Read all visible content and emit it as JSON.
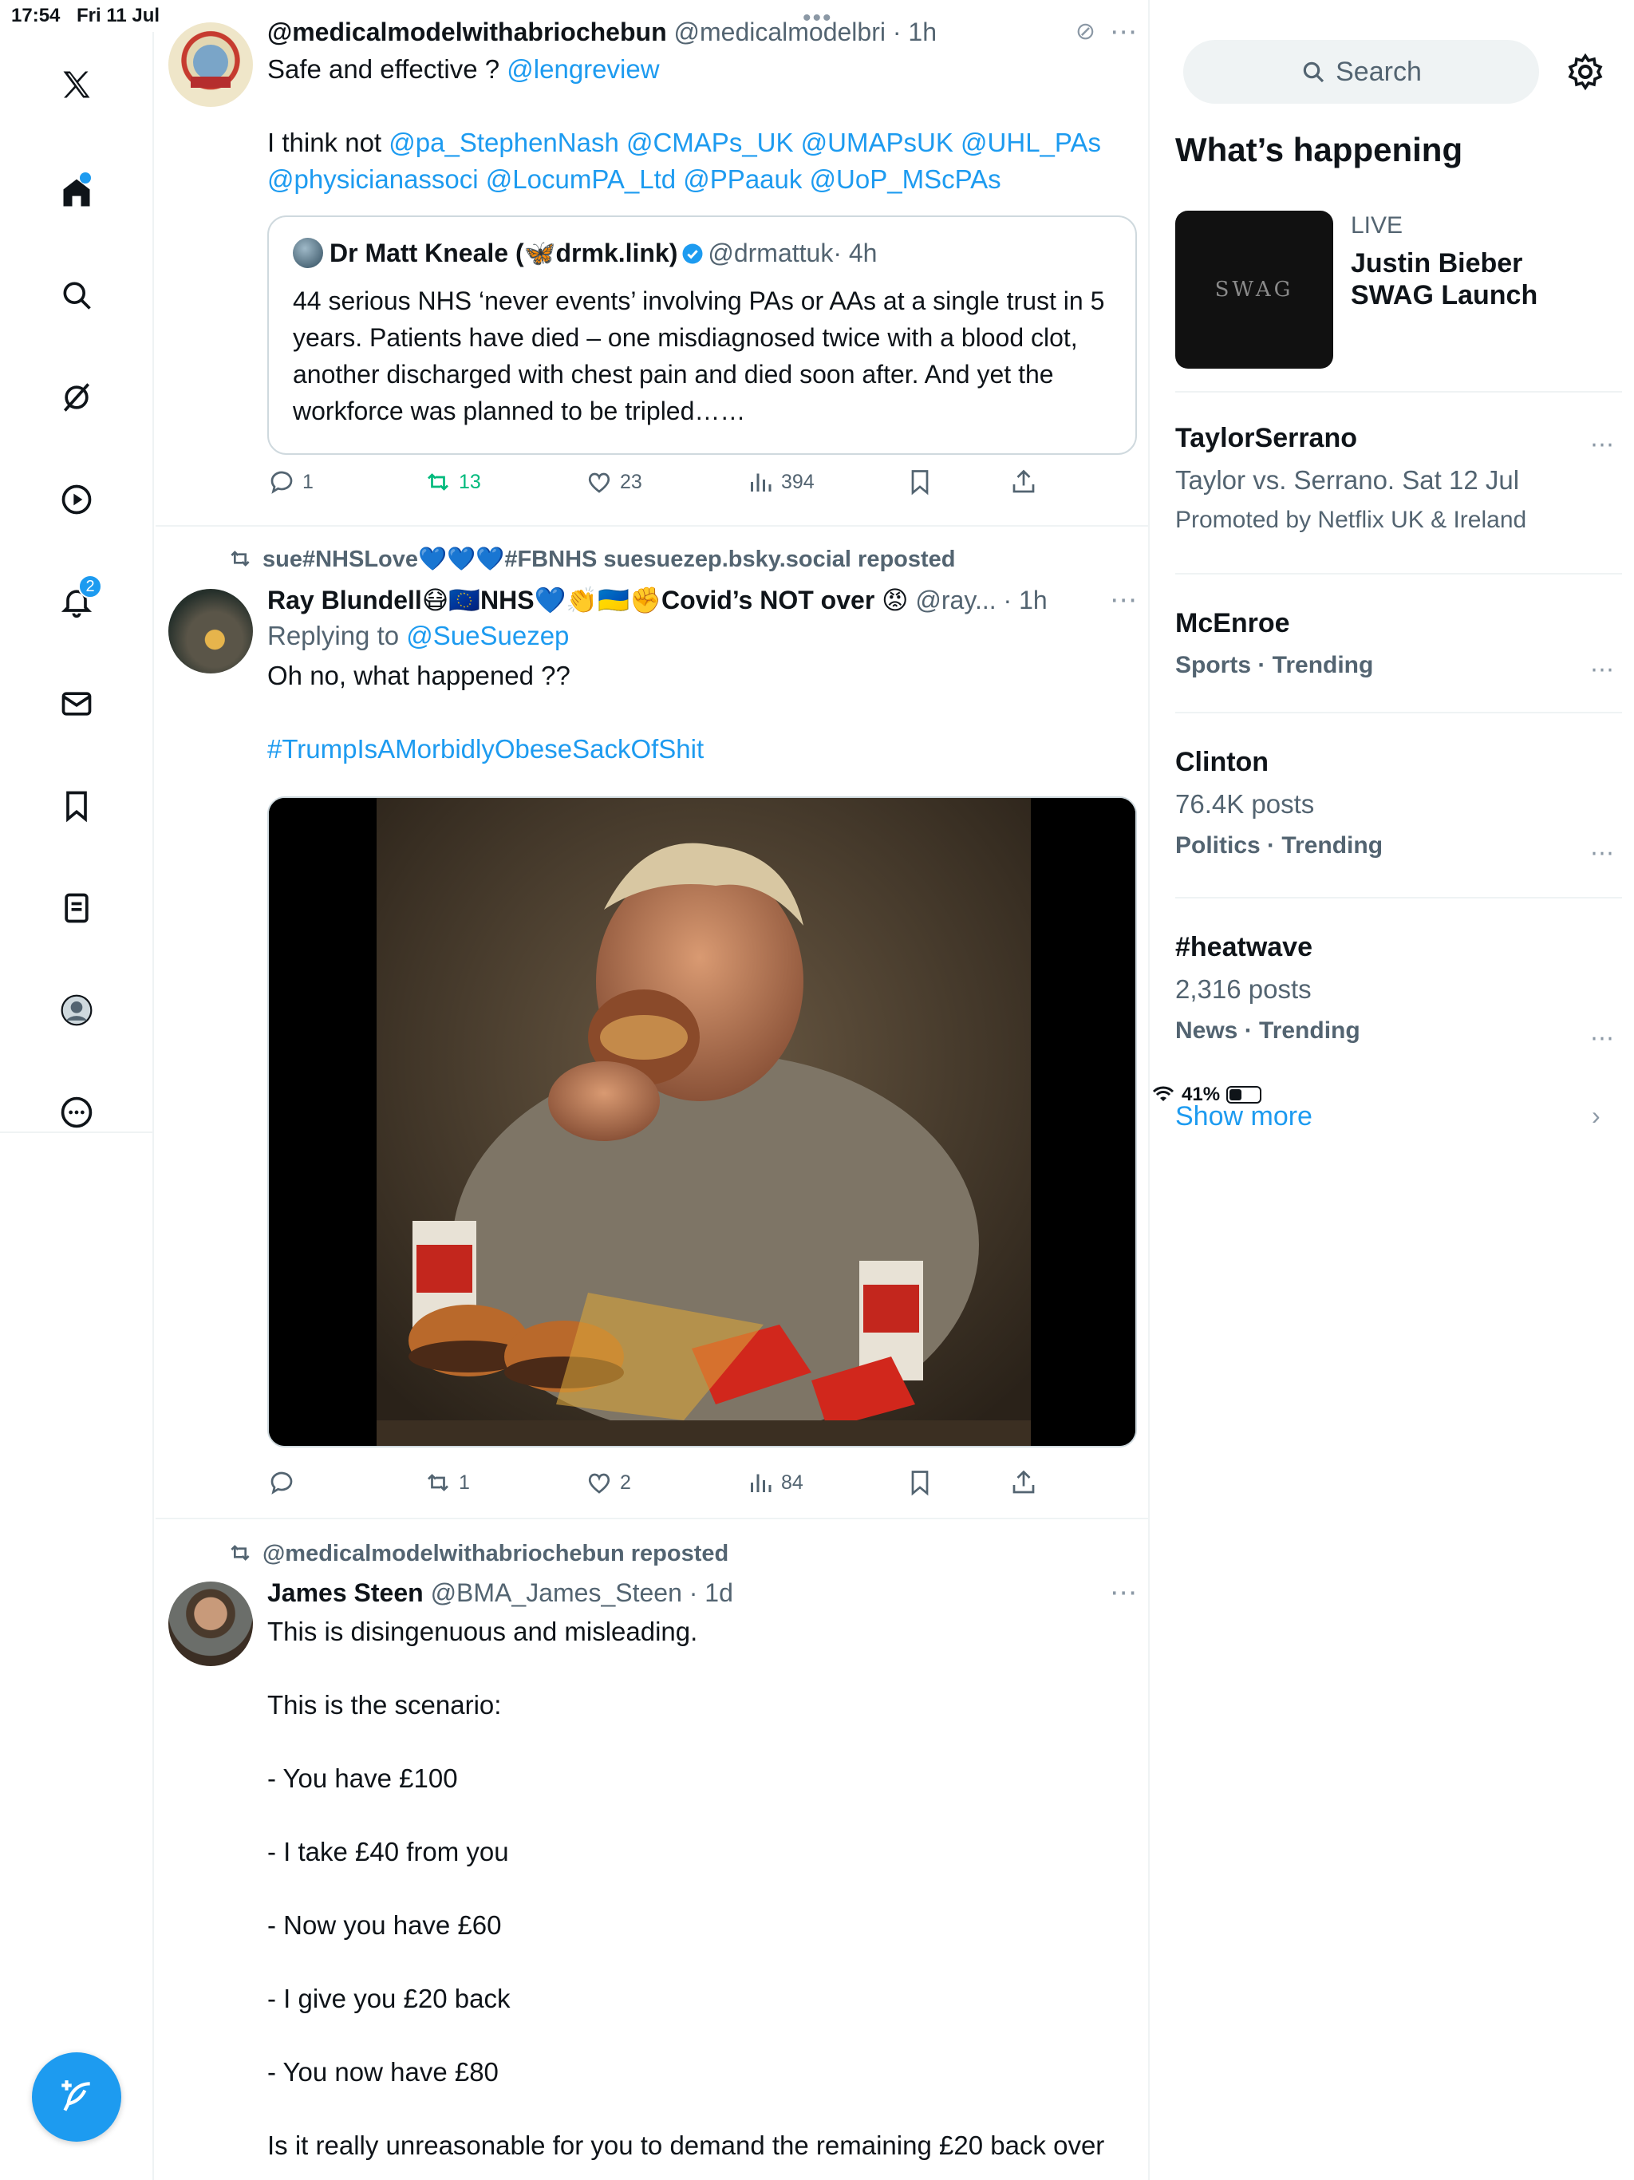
{
  "status_bar": {
    "time": "17:54",
    "date": "Fri 11 Jul",
    "battery": "41%",
    "battery_level": 0.41
  },
  "nav": {
    "items": [
      "x-logo",
      "home",
      "explore",
      "grok",
      "video",
      "notifications",
      "messages",
      "bookmarks",
      "lists",
      "profile",
      "more"
    ],
    "notifications_badge": "2"
  },
  "tweets": [
    {
      "name": "@medicalmodelwithabriochebun",
      "handle": "@medicalmodelbri",
      "time": "· 1h",
      "text_before": "Safe and effective ? ",
      "mention_1": "@lengreview",
      "line2_prefix": "I think not ",
      "mentions_2": "@pa_StephenNash @CMAPs_UK @UMAPsUK @UHL_PAs @physicianassoci @LocumPA_Ltd @PPaauk @UoP_MScPAs",
      "quote": {
        "name": "Dr Matt Kneale (🦋drmk.link)",
        "handle": "@drmattuk",
        "time": "· 4h",
        "text": "44 serious NHS ‘never events’ involving PAs or AAs at a single trust in 5 years. Patients have died – one misdiagnosed twice with a blood clot, another discharged with chest pain and died soon after. And yet the workforce was planned to be tripled……"
      },
      "stats": {
        "replies": "1",
        "reposts": "13",
        "likes": "23",
        "views": "394"
      }
    },
    {
      "repost_by": "sue#NHSLove💙💙💙#FBNHS suesuezep.bsky.social reposted",
      "name": "Ray Blundell😷🇪🇺NHS💙👏🇺🇦✊Covid’s NOT over 😡",
      "handle": "@ray...",
      "time": "· 1h",
      "replying_label": "Replying to ",
      "replying_to": "@SueSuezep",
      "text": "Oh no, what happened ??",
      "hashtag": "#TrumpIsAMorbidlyObeseSackOfShit",
      "stats": {
        "replies": "",
        "reposts": "1",
        "likes": "2",
        "views": "84"
      }
    },
    {
      "repost_by": "@medicalmodelwithabriochebun reposted",
      "name": "James Steen",
      "handle": "@BMA_James_Steen",
      "time": "· 1d",
      "text": "This is disingenuous and misleading.\n\nThis is the scenario:\n\n- You have £100\n\n- I take £40 from you\n\n- Now you have £60\n\n- I give you £20 back\n\n- You now have £80\n\nIs it really unreasonable for you to demand the remaining £20 back over"
    }
  ],
  "right": {
    "search_placeholder": "Search",
    "title": "What’s happening",
    "live": {
      "label": "LIVE",
      "title": "Justin Bieber SWAG Launch",
      "thumb_text": "SWAG"
    },
    "trends": [
      {
        "title": "TaylorSerrano",
        "line2": "Taylor vs. Serrano. Sat 12 Jul",
        "line3": "Promoted by Netflix UK & Ireland"
      },
      {
        "title": "McEnroe",
        "meta": "Sports · Trending"
      },
      {
        "title": "Clinton",
        "posts": "76.4K posts",
        "meta": "Politics · Trending"
      },
      {
        "title": "#heatwave",
        "posts": "2,316 posts",
        "meta": "News · Trending"
      }
    ],
    "show_more": "Show more"
  },
  "colors": {
    "accent": "#1d9bf0",
    "repost_green": "#00ba7c",
    "secondary_text": "#536471"
  }
}
